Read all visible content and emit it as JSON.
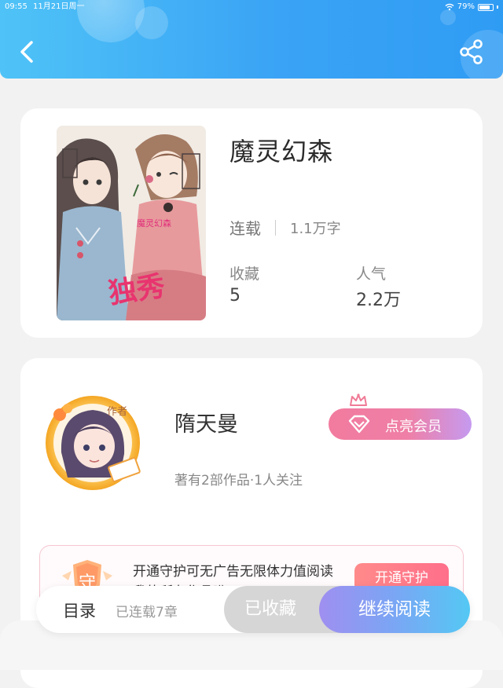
{
  "status_bar": {
    "time": "09:55",
    "date": "11月21日周一",
    "battery": "79%",
    "battery_level": 0.79
  },
  "header": {
    "back_icon": "chevron-left-icon",
    "share_icon": "share-icon",
    "gradient": [
      "#4fc3f7",
      "#2f9cf4"
    ]
  },
  "book": {
    "title": "魔灵幻森",
    "status": "连载",
    "word_count": "1.1万字",
    "collect_label": "收藏",
    "collect_value": "5",
    "popularity_label": "人气",
    "popularity_value": "2.2万",
    "cover": {
      "tag": "魔灵幻森",
      "stamp": "独秀"
    }
  },
  "author": {
    "badge": "作者",
    "name": "隋天曼",
    "stats": "著有2部作品·1人关注",
    "vip_button": "点亮会员"
  },
  "guard": {
    "icon_char": "守",
    "text": "开通守护可无广告无限体力值阅读我的所有作品哟",
    "button": "开通守护"
  },
  "bottom_bar": {
    "toc": "目录",
    "chapter_count": "已连载7章",
    "collected": "已收藏",
    "continue_reading": "继续阅读"
  },
  "colors": {
    "accent_blue": "#3aa3f5",
    "vip_pink": "#f27b9f",
    "read_gradient_start": "#9f8ff0",
    "read_gradient_end": "#54c8f4"
  }
}
